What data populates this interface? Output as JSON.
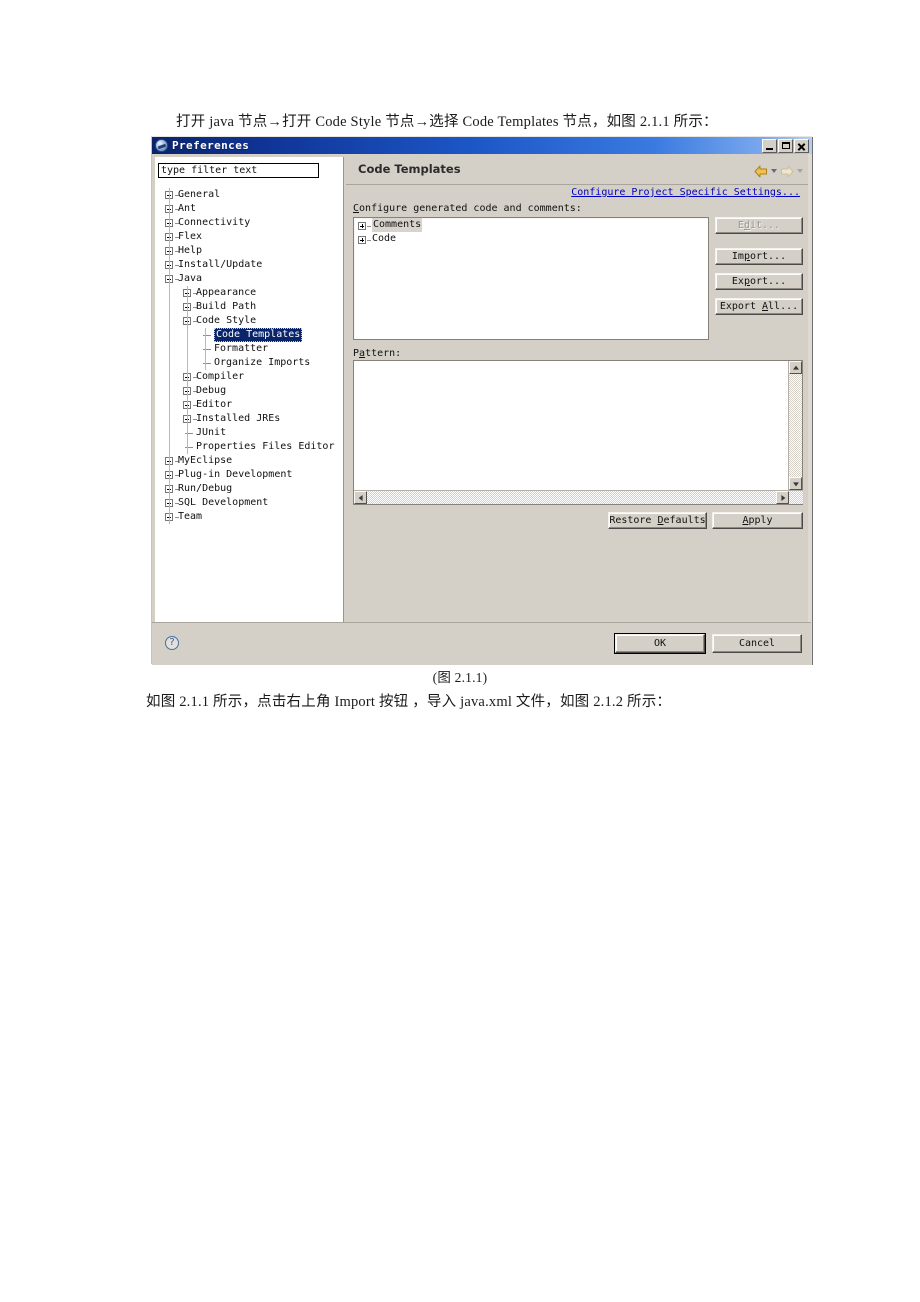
{
  "document": {
    "intro_line": "打开 java 节点→打开 Code Style 节点→选择 Code Templates 节点，如图 2.1.1 所示：",
    "figure_caption": "(图 2.1.1)",
    "following_line": "如图 2.1.1 所示，点击右上角 Import 按钮 ，导入 java.xml 文件，如图 2.1.2 所示："
  },
  "window": {
    "title": "Preferences",
    "titlebar_icon": "preferences-globe-icon",
    "controls": {
      "minimize": "minimize-icon",
      "maximize": "maximize-icon",
      "close": "close-icon"
    }
  },
  "sidebar": {
    "filter": {
      "value": "type filter text",
      "placeholder": "type filter text"
    },
    "items": [
      {
        "label": "General",
        "depth": 0,
        "expander": "plus"
      },
      {
        "label": "Ant",
        "depth": 0,
        "expander": "plus"
      },
      {
        "label": "Connectivity",
        "depth": 0,
        "expander": "plus"
      },
      {
        "label": "Flex",
        "depth": 0,
        "expander": "plus"
      },
      {
        "label": "Help",
        "depth": 0,
        "expander": "plus"
      },
      {
        "label": "Install/Update",
        "depth": 0,
        "expander": "plus"
      },
      {
        "label": "Java",
        "depth": 0,
        "expander": "minus"
      },
      {
        "label": "Appearance",
        "depth": 1,
        "expander": "plus"
      },
      {
        "label": "Build Path",
        "depth": 1,
        "expander": "plus"
      },
      {
        "label": "Code Style",
        "depth": 1,
        "expander": "minus"
      },
      {
        "label": "Code Templates",
        "depth": 2,
        "expander": "none",
        "selected": true
      },
      {
        "label": "Formatter",
        "depth": 2,
        "expander": "none"
      },
      {
        "label": "Organize Imports",
        "depth": 2,
        "expander": "none"
      },
      {
        "label": "Compiler",
        "depth": 1,
        "expander": "plus"
      },
      {
        "label": "Debug",
        "depth": 1,
        "expander": "plus"
      },
      {
        "label": "Editor",
        "depth": 1,
        "expander": "plus"
      },
      {
        "label": "Installed JREs",
        "depth": 1,
        "expander": "plus"
      },
      {
        "label": "JUnit",
        "depth": 1,
        "expander": "none"
      },
      {
        "label": "Properties Files Editor",
        "depth": 1,
        "expander": "none"
      },
      {
        "label": "MyEclipse",
        "depth": 0,
        "expander": "plus"
      },
      {
        "label": "Plug-in Development",
        "depth": 0,
        "expander": "plus"
      },
      {
        "label": "Run/Debug",
        "depth": 0,
        "expander": "plus"
      },
      {
        "label": "SQL Development",
        "depth": 0,
        "expander": "plus"
      },
      {
        "label": "Team",
        "depth": 0,
        "expander": "plus"
      }
    ]
  },
  "content": {
    "page_title": "Code Templates",
    "nav": {
      "back_icon": "back-arrow-icon",
      "back_menu_icon": "chevron-down-icon",
      "forward_icon": "forward-arrow-icon",
      "forward_menu_icon": "chevron-down-icon"
    },
    "configure_link": "Configure Project Specific Settings...",
    "generated_label": "Configure generated code and comments:",
    "templates": [
      {
        "label": "Comments",
        "expander": "plus",
        "highlighted": true
      },
      {
        "label": "Code",
        "expander": "plus",
        "highlighted": false
      }
    ],
    "side_buttons": [
      {
        "label": "Edit...",
        "name": "edit-button",
        "disabled": true
      },
      {
        "label": "Import...",
        "name": "import-button",
        "disabled": false
      },
      {
        "label": "Export...",
        "name": "export-button",
        "disabled": false
      },
      {
        "label": "Export All...",
        "name": "export-all-button",
        "disabled": false
      }
    ],
    "pattern_label": "Pattern:",
    "pattern_value": "",
    "restore_defaults_label": "Restore Defaults",
    "apply_label": "Apply"
  },
  "footer": {
    "help_icon": "help-question-icon",
    "ok_label": "OK",
    "cancel_label": "Cancel"
  },
  "colors": {
    "titlebar_start": "#0a246a",
    "titlebar_end": "#b6cff2",
    "dialog_face": "#d4d0c8",
    "selection": "#0a246a",
    "link": "#0000c0",
    "accent_arrow": "#f2c14b"
  }
}
